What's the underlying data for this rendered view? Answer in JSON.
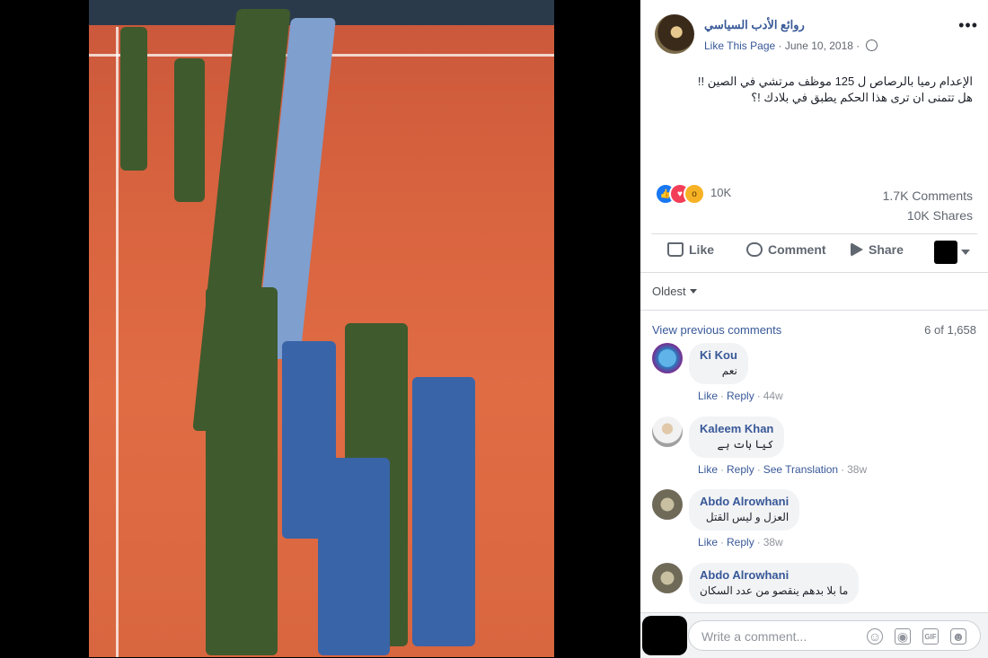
{
  "post": {
    "page_name": "روائع الأدب السياسي",
    "like_page": "Like This Page",
    "separator": "·",
    "date": "June 10, 2018",
    "text_line1": "الإعدام رميا بالرصاص ل 125 موظف مرتشي في الصين !!",
    "text_line2": "هل تتمنى ان ترى هذا الحكم يطبق في بلادك !؟",
    "more_icon": "more-options-icon"
  },
  "reactions": {
    "count": "10K",
    "types": [
      "like",
      "love",
      "wow"
    ],
    "colors": {
      "like": "#1877f2",
      "love": "#f33e58",
      "wow": "#f7b125"
    }
  },
  "stats": {
    "comments": "1.7K Comments",
    "shares": "10K Shares"
  },
  "actions": {
    "like": "Like",
    "comment": "Comment",
    "share": "Share"
  },
  "comments_section": {
    "sort": "Oldest",
    "view_previous": "View previous comments",
    "pager": "6 of 1,658",
    "items": [
      {
        "name": "Ki Kou",
        "text": "نعم",
        "actions": [
          "Like",
          "Reply"
        ],
        "time": "44w"
      },
      {
        "name": "Kaleem Khan",
        "text": "کیا بات ہے",
        "actions": [
          "Like",
          "Reply",
          "See Translation"
        ],
        "time": "38w"
      },
      {
        "name": "Abdo Alrowhani",
        "text": "العزل و ليس القتل",
        "actions": [
          "Like",
          "Reply"
        ],
        "time": "38w"
      },
      {
        "name": "Abdo Alrowhani",
        "text": "ما بلا بدهم ينقصو من عدد السكان"
      }
    ]
  },
  "composer": {
    "placeholder": "Write a comment...",
    "tools": [
      "emoji-icon",
      "camera-icon",
      "gif-icon",
      "sticker-icon"
    ],
    "gif_label": "GIF"
  }
}
